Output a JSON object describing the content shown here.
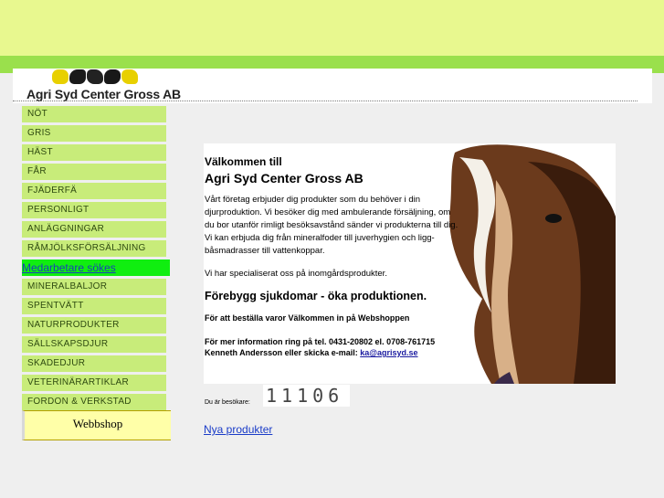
{
  "header": {
    "company_name": "Agri Syd Center Gross AB"
  },
  "menu": {
    "items": [
      {
        "label": "NÖT"
      },
      {
        "label": "GRIS"
      },
      {
        "label": "HÄST"
      },
      {
        "label": "FÅR"
      },
      {
        "label": "FJÄDERFÄ"
      },
      {
        "label": "PERSONLIGT"
      },
      {
        "label": "ANLÄGGNINGAR"
      },
      {
        "label": "RÅMJÖLKSFÖRSÄLJNING"
      },
      {
        "label": "Medarbetare sökes"
      },
      {
        "label": "MINERALBALJOR"
      },
      {
        "label": "SPENTVÄTT"
      },
      {
        "label": "NATURPRODUKTER"
      },
      {
        "label": "SÄLLSKAPSDJUR"
      },
      {
        "label": "SKADEDJUR"
      },
      {
        "label": "VETERINÄRARTIKLAR"
      },
      {
        "label": "FORDON & VERKSTAD"
      }
    ],
    "webshop_label": "Webbshop"
  },
  "content": {
    "welcome": "Välkommen till",
    "company": "Agri Syd Center Gross AB",
    "intro": "Vårt företag erbjuder dig produkter som du behöver i din djurproduktion. Vi besöker dig med ambulerande försäljning, om du bor utanför rimligt besöksavstånd sänder vi produkterna till dig. Vi kan erbjuda dig från mineralfoder till juverhygien och ligg- båsmadrasser till vattenkoppar.",
    "special": "Vi har specialiserat oss på inomgårdsprodukter.",
    "prevent": "Förebygg sjukdomar - öka produktionen.",
    "order": "För att beställa varor Välkommen in på Webshoppen",
    "info_line1": "För mer information ring på tel. 0431-20802 el. 0708-761715",
    "info_line2_prefix": "Kenneth Andersson eller skicka e-mail: ",
    "email": "ka@agrisyd.se"
  },
  "visitor": {
    "label": "Du är besökare:",
    "count": "11106"
  },
  "new_products_link": "Nya produkter",
  "colors": {
    "top_band": "#e8f88f",
    "green_strip": "#9ae04c",
    "menu_item": "#c8ec7a",
    "menu_highlight": "#10ee10",
    "webshop": "#ffffa8"
  }
}
